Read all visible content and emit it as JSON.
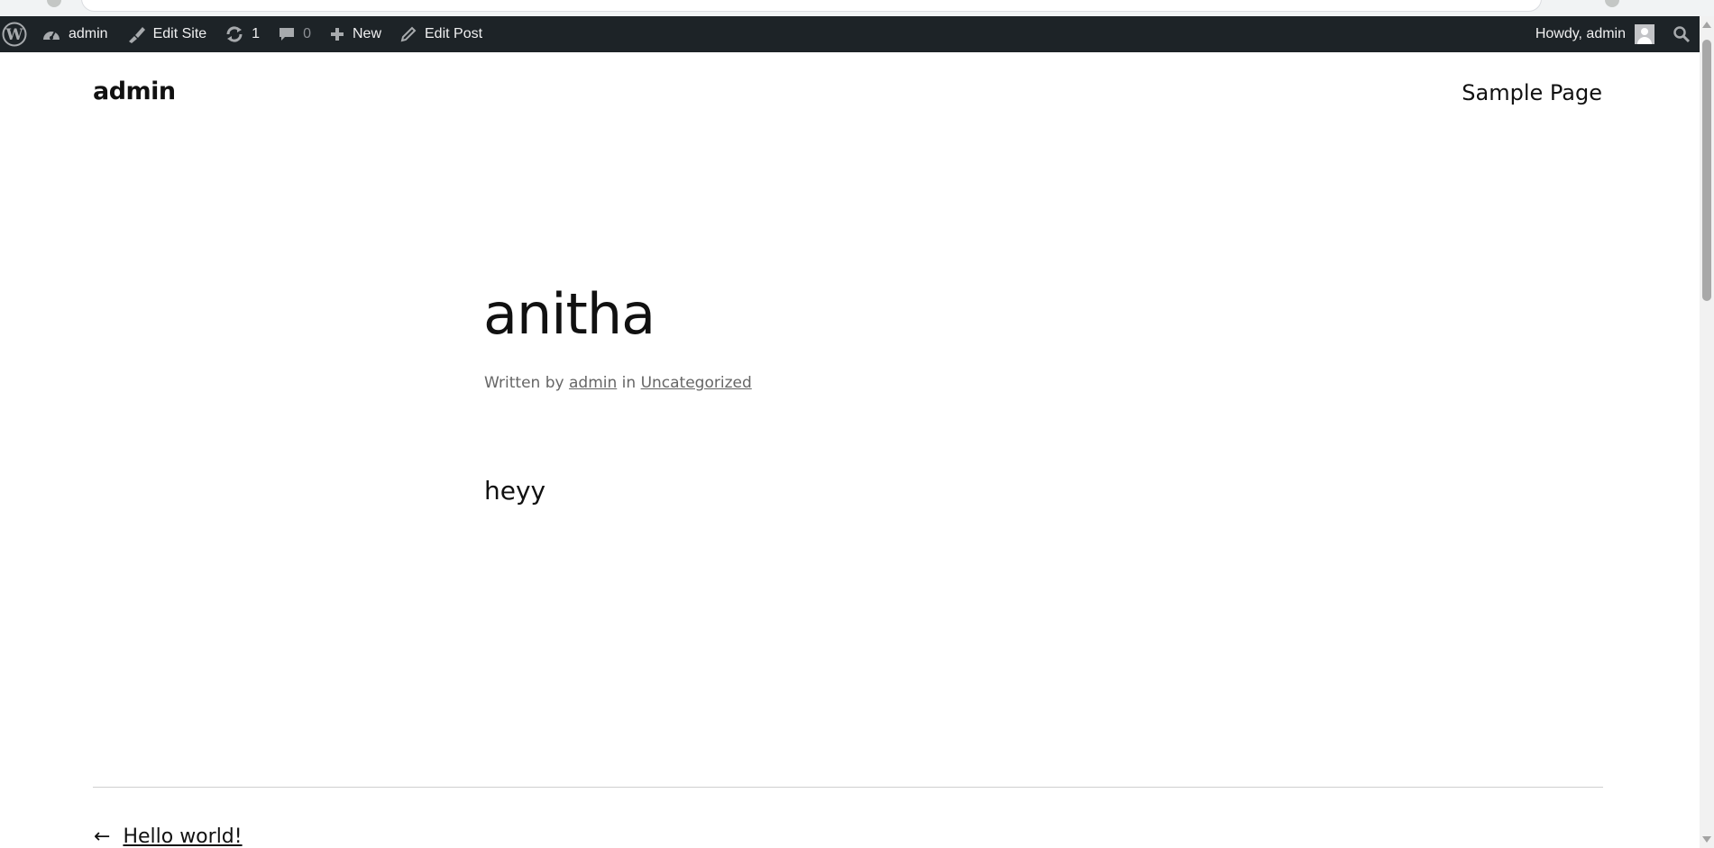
{
  "admin_bar": {
    "site_name": "admin",
    "edit_site": "Edit Site",
    "updates_count": "1",
    "comments_count": "0",
    "new_label": "New",
    "edit_post": "Edit Post",
    "howdy": "Howdy, admin",
    "background": "#1d2327"
  },
  "header": {
    "site_title": "admin",
    "nav_item": "Sample Page"
  },
  "post": {
    "title": "anitha",
    "meta_written_by": "Written by",
    "meta_author": "admin",
    "meta_in": "in",
    "meta_category": "Uncategorized",
    "content": "heyy"
  },
  "navigation": {
    "prev_arrow": "←",
    "prev_title": "Hello world!"
  }
}
